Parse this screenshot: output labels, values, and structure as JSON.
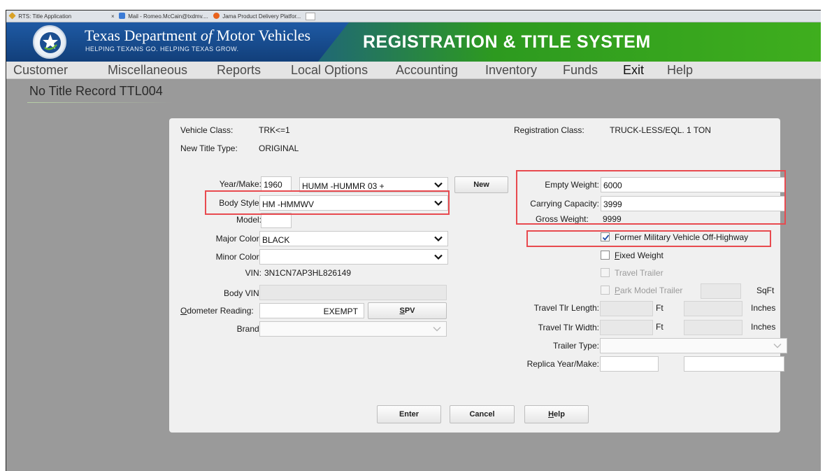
{
  "browser_tabs": [
    {
      "label": "RTS: Title Application",
      "icon": "star-icon",
      "color": "#d9a227"
    },
    {
      "label": "Mail - Romeo.McCain@txdmv....",
      "icon": "mail-icon",
      "color": "#3b7bd6"
    },
    {
      "label": "Jama Product Delivery Platfor...",
      "icon": "jama-icon",
      "color": "#e8621c"
    }
  ],
  "tab_close_glyph": "×",
  "banner": {
    "agency_part1": "Texas Department ",
    "agency_of": "of",
    "agency_part2": " Motor Vehicles",
    "tagline": "HELPING TEXANS GO. HELPING TEXAS GROW.",
    "system_title": "REGISTRATION & TITLE SYSTEM",
    "colors": {
      "blue": "#123f7a",
      "green": "#3fae1e"
    }
  },
  "menu": [
    "Customer",
    "Miscellaneous",
    "Reports",
    "Local Options",
    "Accounting",
    "Inventory",
    "Funds",
    "Exit",
    "Help"
  ],
  "screen_title": "No Title Record TTL004",
  "info": {
    "vehicle_class_label": "Vehicle Class:",
    "vehicle_class_value": "TRK<=1",
    "new_title_type_label": "New Title Type:",
    "new_title_type_value": "ORIGINAL",
    "registration_class_label": "Registration Class:",
    "registration_class_value": "TRUCK-LESS/EQL. 1 TON"
  },
  "form_left": {
    "year_make_label": "Year/Make:",
    "year_value": "1960",
    "make_value": "HUMM -HUMMR 03 +",
    "new_button": "New",
    "body_style_label": "Body Style:",
    "body_style_value": "HM -HMMWV",
    "model_label": "Model:",
    "model_value": "",
    "major_color_label": "Major Color:",
    "major_color_value": "BLACK",
    "minor_color_label": "Minor Color:",
    "minor_color_value": "",
    "vin_label": "VIN:",
    "vin_value": "3N1CN7AP3HL826149",
    "body_vin_label": "Body VIN:",
    "body_vin_value": "",
    "odometer_label_first": "O",
    "odometer_label_rest": "dometer Reading:",
    "odometer_value": "EXEMPT",
    "spv_first": "S",
    "spv_rest": "PV",
    "brand_label": "Brand:",
    "brand_value": ""
  },
  "form_right": {
    "empty_weight_label": "Empty Weight:",
    "empty_weight_value": "6000",
    "carrying_capacity_label": "Carrying Capacity:",
    "carrying_capacity_value": "3999",
    "gross_weight_label": "Gross Weight:",
    "gross_weight_value": "9999",
    "former_military_label": "Former Military Vehicle Off-Highway",
    "former_military_checked": true,
    "fixed_weight_first": "F",
    "fixed_weight_rest": "ixed Weight",
    "fixed_weight_checked": false,
    "travel_trailer_label": "Travel Trailer",
    "park_model_first": "P",
    "park_model_rest": "ark Model Trailer",
    "sqft_unit": "SqFt",
    "travel_length_label": "Travel Tlr Length:",
    "travel_width_label": "Travel Tlr Width:",
    "ft_unit": "Ft",
    "inches_unit": "Inches",
    "trailer_type_label": "Trailer Type:",
    "trailer_type_value": "",
    "replica_label": "Replica Year/Make:"
  },
  "actions": {
    "enter": "Enter",
    "cancel": "Cancel",
    "help_first": "H",
    "help_rest": "elp"
  },
  "highlight_color": "#e84a4f"
}
